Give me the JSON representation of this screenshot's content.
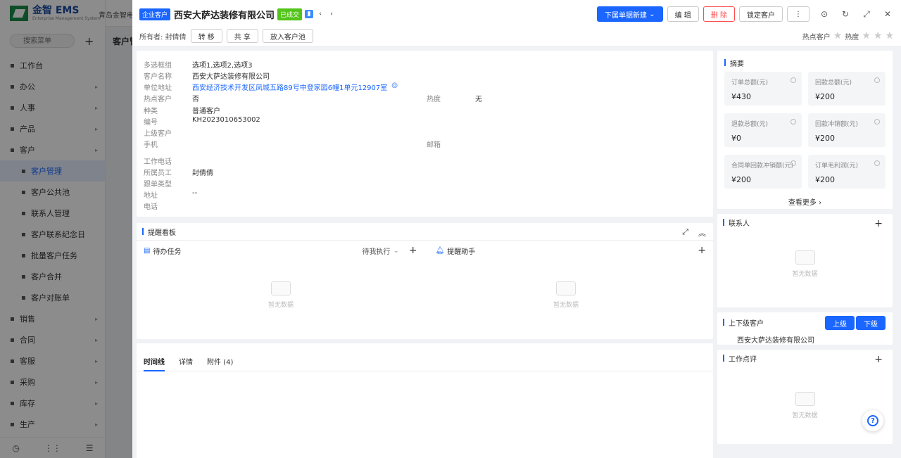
{
  "app": {
    "logo_text": "金智 EMS",
    "logo_sub": "Enterprise Management System",
    "company": "青岛金智电子",
    "page_title_bg": "客户管"
  },
  "sidebar": {
    "search_placeholder": "搜索菜单",
    "items": [
      {
        "label": "工作台",
        "icon": "grid-icon"
      },
      {
        "label": "办公",
        "icon": "office-icon"
      },
      {
        "label": "人事",
        "icon": "person-icon"
      },
      {
        "label": "产品",
        "icon": "product-icon"
      },
      {
        "label": "客户",
        "icon": "customer-icon"
      },
      {
        "label": "客户管理",
        "sub": true,
        "active": true
      },
      {
        "label": "客户公共池",
        "sub": true
      },
      {
        "label": "联系人管理",
        "sub": true
      },
      {
        "label": "客户联系纪念日",
        "sub": true
      },
      {
        "label": "批量客户任务",
        "sub": true
      },
      {
        "label": "客户合并",
        "sub": true
      },
      {
        "label": "客户对账单",
        "sub": true
      },
      {
        "label": "销售",
        "icon": "sales-icon"
      },
      {
        "label": "合同",
        "icon": "contract-icon"
      },
      {
        "label": "客服",
        "icon": "service-icon"
      },
      {
        "label": "采购",
        "icon": "purchase-icon"
      },
      {
        "label": "库存",
        "icon": "stock-icon"
      },
      {
        "label": "生产",
        "icon": "production-icon"
      }
    ]
  },
  "drawer": {
    "type_tag": "企业客户",
    "customer_name": "西安大萨达装修有限公司",
    "status_tag": "已成交",
    "buttons": {
      "create": "下属单据新建",
      "edit": "编 辑",
      "delete": "删 除",
      "lock": "锁定客户",
      "transfer": "转 移",
      "share": "共 享",
      "to_pool": "放入客户池"
    },
    "owner_label": "所有者:",
    "owner_name": "封倩倩",
    "hot_label": "热点客户",
    "heat_label": "热度"
  },
  "info": {
    "multi_label": "多选框组",
    "multi_value": "选项1,选项2,选项3",
    "name_label": "客户名称",
    "name_value": "西安大萨达装修有限公司",
    "addr_label": "单位地址",
    "addr_value": "西安经济技术开发区凤城五路89号中登家园6幢1单元12907室",
    "hot_label": "热点客户",
    "hot_value": "否",
    "heat_label": "热度",
    "heat_value": "无",
    "kind_label": "种类",
    "kind_value": "普通客户",
    "code_label": "编号",
    "code_value": "KH2023010653002",
    "parent_label": "上级客户",
    "mobile_label": "手机",
    "email_label": "邮箱",
    "workphone_label": "工作电话",
    "staff_label": "所属员工",
    "staff_value": "封倩倩",
    "followtype_label": "跟单类型",
    "address_label": "地址",
    "address_value": "--",
    "phone_label": "电话"
  },
  "remind": {
    "title": "提醒看板",
    "todo": "待办任务",
    "filter": "待我执行",
    "assistant": "提醒助手",
    "empty": "暂无数据"
  },
  "timeline": {
    "tabs": [
      "时间线",
      "详情",
      "附件 (4)"
    ]
  },
  "summary": {
    "title": "摘要",
    "boxes": [
      {
        "label": "订单总额(元)",
        "value": "¥430"
      },
      {
        "label": "回款总额(元)",
        "value": "¥200"
      },
      {
        "label": "退款总额(元)",
        "value": "¥0"
      },
      {
        "label": "回款冲销额(元)",
        "value": "¥200"
      },
      {
        "label": "合同单回款冲销额(元)",
        "value": "¥200"
      },
      {
        "label": "订单毛利润(元)",
        "value": "¥200"
      }
    ],
    "more": "查看更多"
  },
  "contacts": {
    "title": "联系人",
    "empty": "暂无数据"
  },
  "updown": {
    "title": "上下级客户",
    "up": "上级",
    "down": "下级",
    "item": "西安大萨达装修有限公司"
  },
  "review": {
    "title": "工作点评",
    "empty": "暂无数据"
  }
}
